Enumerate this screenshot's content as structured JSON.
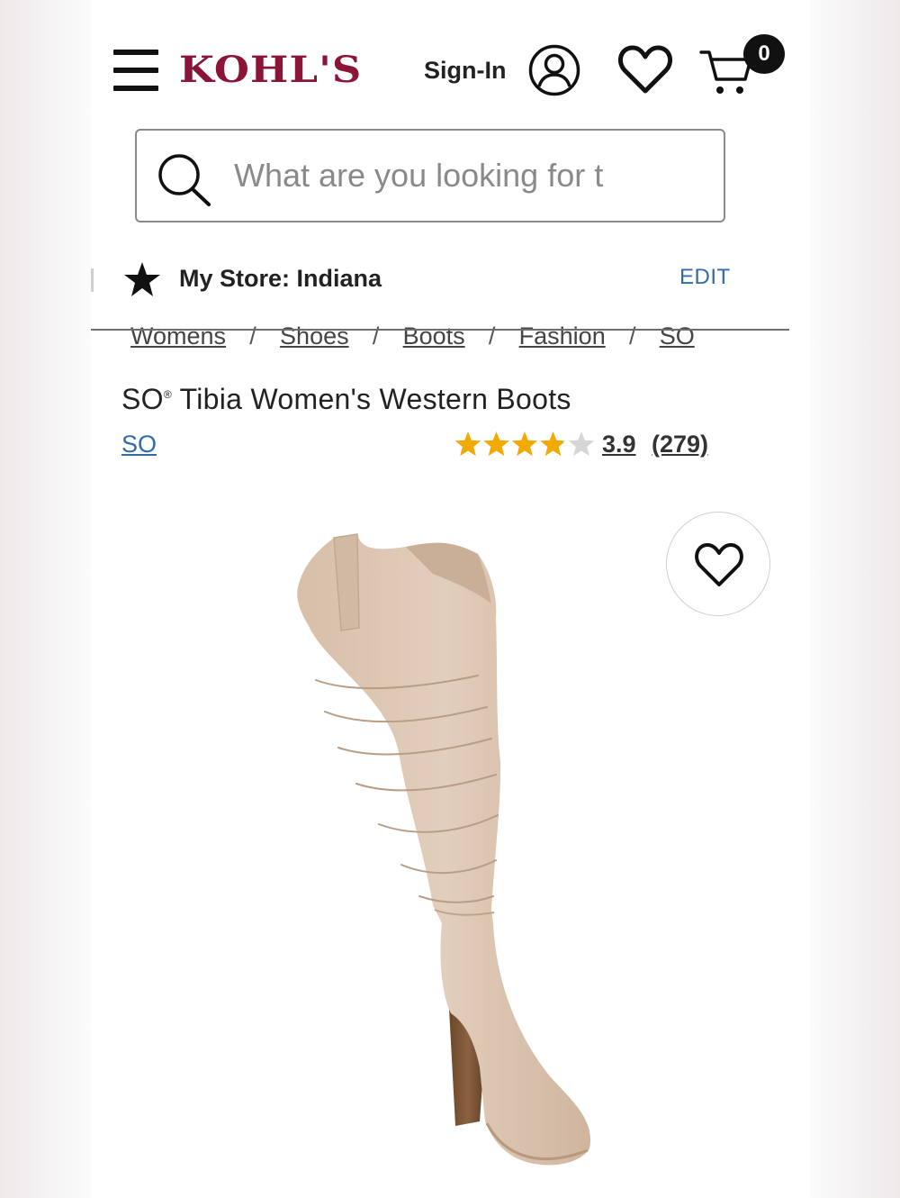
{
  "header": {
    "logo_text": "KOHL'S",
    "signin_label": "Sign-In",
    "cart_count": "0",
    "icons": [
      "menu-icon",
      "account-icon",
      "heart-icon",
      "cart-icon"
    ]
  },
  "search": {
    "placeholder": "What are you looking for t",
    "icon": "search-icon"
  },
  "store": {
    "label": "My Store: Indiana",
    "edit_label": "EDIT",
    "icon": "star-icon"
  },
  "breadcrumb": [
    "Womens",
    "Shoes",
    "Boots",
    "Fashion",
    "SO"
  ],
  "breadcrumb_separator": "/",
  "product": {
    "brand_prefix": "SO",
    "registered_mark": "®",
    "title_rest": " Tibia Women's Western Boots",
    "brand_link": "SO",
    "rating_value": "3.9",
    "rating_count": "(279)",
    "stars_filled": 3.9,
    "stars_total": 5
  },
  "colors": {
    "brand": "#8b1538",
    "link": "#2f6ca8",
    "star": "#f2a900",
    "boot": "#dcc6b2",
    "heel": "#7a5535"
  }
}
